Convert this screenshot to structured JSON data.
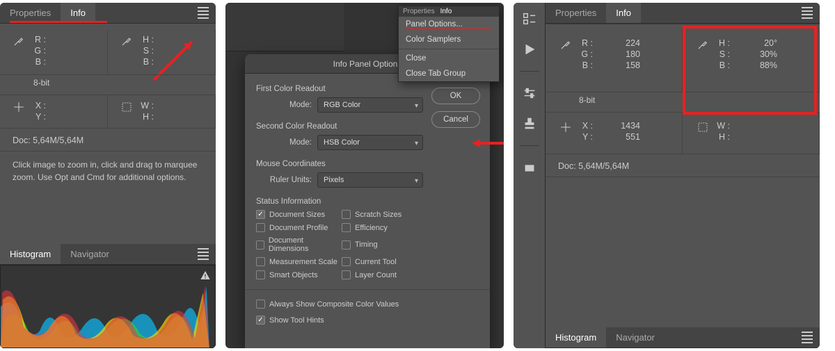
{
  "panel1": {
    "tabs": {
      "properties": "Properties",
      "info": "Info"
    },
    "first": {
      "r": "R :",
      "g": "G :",
      "b": "B :"
    },
    "second": {
      "h": "H :",
      "s": "S :",
      "b": "B :"
    },
    "bits": "8-bit",
    "xy": {
      "x": "X :",
      "y": "Y :"
    },
    "wh": {
      "w": "W :",
      "h": "H :"
    },
    "doc": "Doc: 5,64M/5,64M",
    "hint": "Click image to zoom in, click and drag to marquee zoom.  Use Opt and Cmd for additional options.",
    "hist_tabs": {
      "histogram": "Histogram",
      "navigator": "Navigator"
    }
  },
  "panel2": {
    "ctx": {
      "props": "Properties",
      "info": "Info",
      "panelOptions": "Panel Options...",
      "colorSamplers": "Color Samplers",
      "close": "Close",
      "closeGroup": "Close Tab Group"
    },
    "dialog": {
      "title": "Info Panel Options",
      "first_label": "First Color Readout",
      "second_label": "Second Color Readout",
      "mode_label": "Mode:",
      "mode_rgb": "RGB Color",
      "mode_hsb": "HSB Color",
      "mouse_label": "Mouse Coordinates",
      "ruler_label": "Ruler Units:",
      "ruler_val": "Pixels",
      "status_label": "Status Information",
      "ok": "OK",
      "cancel": "Cancel",
      "cb": {
        "docSizes": "Document Sizes",
        "scratch": "Scratch Sizes",
        "profile": "Document Profile",
        "eff": "Efficiency",
        "dims": "Document Dimensions",
        "timing": "Timing",
        "mscale": "Measurement Scale",
        "curtool": "Current Tool",
        "smart": "Smart Objects",
        "layercount": "Layer Count"
      },
      "always": "Always Show Composite Color Values",
      "hints": "Show Tool Hints"
    }
  },
  "panel3": {
    "tabs": {
      "properties": "Properties",
      "info": "Info"
    },
    "rgb": {
      "r": "R :",
      "g": "G :",
      "b": "B :",
      "rv": "224",
      "gv": "180",
      "bv": "158"
    },
    "hsb": {
      "h": "H :",
      "s": "S :",
      "b": "B :",
      "hv": "20°",
      "sv": "30%",
      "bv": "88%"
    },
    "bits": "8-bit",
    "xy": {
      "x": "X :",
      "y": "Y :",
      "xv": "1434",
      "yv": "551"
    },
    "wh": {
      "w": "W :",
      "h": "H :"
    },
    "doc": "Doc: 5,64M/5,64M",
    "hist_tabs": {
      "histogram": "Histogram",
      "navigator": "Navigator"
    }
  }
}
